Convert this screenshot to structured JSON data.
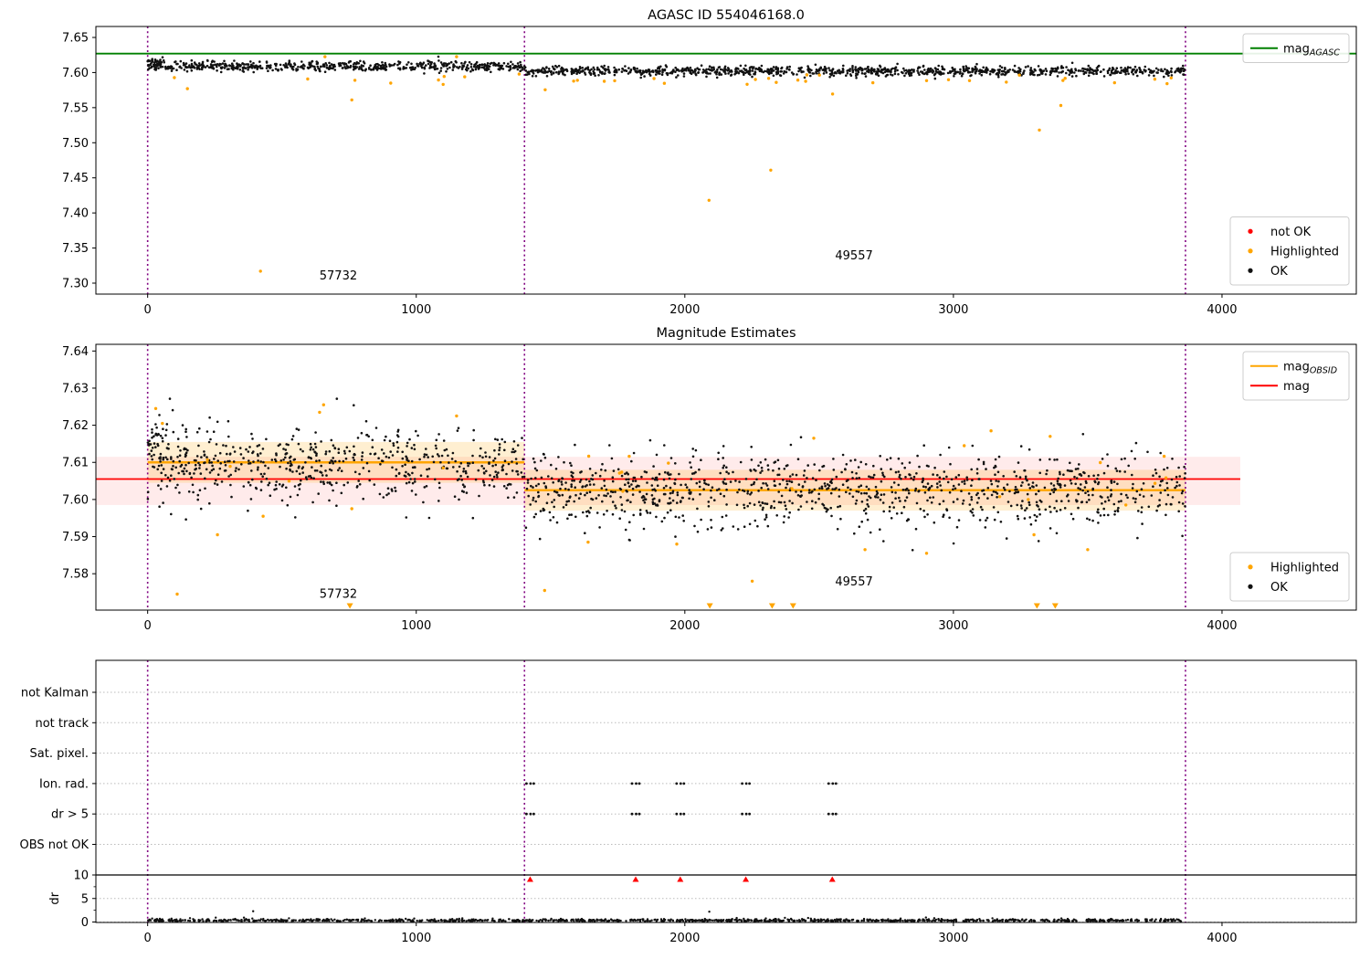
{
  "colors": {
    "green": "#008000",
    "orange": "#ffa500",
    "red": "#ff0000",
    "purple": "#800080",
    "black": "#111111",
    "pink_band": "rgba(255,0,0,0.08)",
    "orange_band": "rgba(255,165,0,0.18)",
    "grid": "#bbbbbb",
    "spine": "#000000",
    "background": "#ffffff"
  },
  "chart_data": [
    {
      "id": "agasc",
      "type": "scatter",
      "title": "AGASC ID 554046168.0",
      "xlim": [
        -192.7,
        4500
      ],
      "ylim": [
        7.2844,
        7.6656
      ],
      "xticks": [
        0,
        1000,
        2000,
        3000,
        4000
      ],
      "yticks": [
        7.3,
        7.35,
        7.4,
        7.45,
        7.5,
        7.55,
        7.6,
        7.65
      ],
      "ydecimals": 2,
      "vlines": {
        "x": [
          0,
          1403,
          3864
        ],
        "color": "purple",
        "style": "dotted"
      },
      "hlines": [
        {
          "y": 7.627,
          "x0": -192.7,
          "x1": 4500,
          "color": "green",
          "width": 1.8
        }
      ],
      "annotations": [
        {
          "text": "57732",
          "x": 710,
          "y": 7.305
        },
        {
          "text": "49557",
          "x": 2630,
          "y": 7.334
        }
      ],
      "ok_series": {
        "name": "OK",
        "color": "black",
        "clusters": [
          {
            "x0": 0,
            "x1": 60,
            "mean": 7.6135,
            "sd": 0.004,
            "n": 30
          },
          {
            "x0": 0,
            "x1": 1403,
            "mean": 7.609,
            "sd": 0.0035,
            "n": 620
          },
          {
            "x0": 1403,
            "x1": 3864,
            "mean": 7.602,
            "sd": 0.0035,
            "n": 1050
          }
        ]
      },
      "highlighted_series": {
        "name": "Highlighted",
        "color": "orange",
        "random": {
          "x0": 60,
          "x1": 3840,
          "ymin": 7.583,
          "ymax": 7.5995,
          "n": 26
        },
        "points": [
          [
            148,
            7.577
          ],
          [
            420,
            7.317
          ],
          [
            660,
            7.6225
          ],
          [
            760,
            7.561
          ],
          [
            905,
            7.585
          ],
          [
            1150,
            7.6225
          ],
          [
            1480,
            7.5755
          ],
          [
            1600,
            7.589
          ],
          [
            1700,
            7.5875
          ],
          [
            2090,
            7.418
          ],
          [
            2320,
            7.461
          ],
          [
            2450,
            7.5875
          ],
          [
            2550,
            7.5695
          ],
          [
            2700,
            7.5855
          ],
          [
            2900,
            7.5885
          ],
          [
            3060,
            7.5885
          ],
          [
            3320,
            7.518
          ],
          [
            3400,
            7.553
          ],
          [
            3600,
            7.5855
          ],
          [
            3750,
            7.5905
          ]
        ]
      },
      "notok_series": {
        "name": "not OK",
        "color": "red",
        "points": []
      },
      "legends": [
        {
          "pos": "top-right",
          "w": 116,
          "items": [
            {
              "marker": "line",
              "color": "green",
              "label": "mag",
              "sub": "AGASC"
            }
          ]
        },
        {
          "pos": "bottom-right",
          "w": 130,
          "items": [
            {
              "marker": "dot",
              "color": "red",
              "label": "not OK"
            },
            {
              "marker": "dot",
              "color": "orange",
              "label": "Highlighted"
            },
            {
              "marker": "dot",
              "color": "black",
              "label": "OK"
            }
          ]
        }
      ]
    },
    {
      "id": "magest",
      "type": "scatter",
      "title": "Magnitude Estimates",
      "xlim": [
        -192.7,
        4500
      ],
      "ylim": [
        7.5702,
        7.6418
      ],
      "xticks": [
        0,
        1000,
        2000,
        3000,
        4000
      ],
      "yticks": [
        7.58,
        7.59,
        7.6,
        7.61,
        7.62,
        7.63,
        7.64
      ],
      "ydecimals": 2,
      "vlines": {
        "x": [
          0,
          1403,
          3864
        ],
        "color": "purple",
        "style": "dotted"
      },
      "bands": [
        {
          "x0": -192.7,
          "x1": 4068,
          "y0": 7.5985,
          "y1": 7.6115,
          "color": "pink_band"
        },
        {
          "x0": 0,
          "x1": 1403,
          "y0": 7.6045,
          "y1": 7.6155,
          "color": "orange_band"
        },
        {
          "x0": 1403,
          "x1": 3864,
          "y0": 7.597,
          "y1": 7.608,
          "color": "orange_band"
        }
      ],
      "hlines": [
        {
          "y": 7.6055,
          "x0": -192.7,
          "x1": 4068,
          "color": "red",
          "width": 1.8
        },
        {
          "y": 7.61,
          "x0": 0,
          "x1": 1403,
          "color": "orange",
          "width": 2.4
        },
        {
          "y": 7.6025,
          "x0": 1403,
          "x1": 3864,
          "color": "orange",
          "width": 2.4
        }
      ],
      "annotations": [
        {
          "text": "57732",
          "x": 710,
          "y": 7.5735
        },
        {
          "text": "49557",
          "x": 2630,
          "y": 7.5768
        }
      ],
      "ok_series": {
        "name": "OK",
        "color": "black",
        "clusters": [
          {
            "x0": 0,
            "x1": 90,
            "mean": 7.6155,
            "sd": 0.005,
            "n": 35
          },
          {
            "x0": 0,
            "x1": 1403,
            "mean": 7.6095,
            "sd": 0.005,
            "n": 600
          },
          {
            "x0": 1403,
            "x1": 3864,
            "mean": 7.6025,
            "sd": 0.005,
            "n": 1050
          }
        ]
      },
      "highlighted_series": {
        "name": "Highlighted",
        "color": "orange",
        "random": {
          "x0": 30,
          "x1": 3840,
          "ymin": 7.5985,
          "ymax": 7.6125,
          "n": 18
        },
        "points": [
          [
            30,
            7.6245
          ],
          [
            55,
            7.6205
          ],
          [
            110,
            7.5745
          ],
          [
            260,
            7.5905
          ],
          [
            430,
            7.5955
          ],
          [
            640,
            7.6235
          ],
          [
            655,
            7.6255
          ],
          [
            760,
            7.5975
          ],
          [
            1150,
            7.6225
          ],
          [
            1478,
            7.5755
          ],
          [
            1640,
            7.5885
          ],
          [
            1970,
            7.588
          ],
          [
            2251,
            7.578
          ],
          [
            2480,
            7.6165
          ],
          [
            2671,
            7.5865
          ],
          [
            2900,
            7.5855
          ],
          [
            3040,
            7.6145
          ],
          [
            3140,
            7.6185
          ],
          [
            3300,
            7.5905
          ],
          [
            3360,
            7.617
          ],
          [
            3500,
            7.5865
          ]
        ],
        "clip_triangles_x": [
          753,
          2093,
          2325,
          2403,
          3311,
          3379
        ]
      },
      "legends": [
        {
          "pos": "top-right",
          "w": 116,
          "items": [
            {
              "marker": "line",
              "color": "orange",
              "label": "mag",
              "sub": "OBSID"
            },
            {
              "marker": "line",
              "color": "red",
              "label": "mag"
            }
          ]
        },
        {
          "pos": "bottom-right",
          "w": 130,
          "items": [
            {
              "marker": "dot",
              "color": "orange",
              "label": "Highlighted"
            },
            {
              "marker": "dot",
              "color": "black",
              "label": "OK"
            }
          ]
        }
      ]
    },
    {
      "id": "flags",
      "type": "scatter",
      "title": "",
      "xlim": [
        -192.7,
        4500
      ],
      "xticks": [
        0,
        1000,
        2000,
        3000,
        4000
      ],
      "vlines": {
        "x": [
          0,
          1403,
          3864
        ],
        "color": "purple",
        "style": "dotted"
      },
      "flag_rows": [
        "not Kalman",
        "not track",
        "Sat. pixel.",
        "Ion. rad.",
        "dr > 5",
        "OBS not OK"
      ],
      "flag_points": [
        {
          "row": "Ion. rad.",
          "x": [
            1424,
            1817,
            1983,
            2227,
            2549
          ]
        },
        {
          "row": "dr > 5",
          "x": [
            1424,
            1817,
            1983,
            2227,
            2549
          ]
        }
      ],
      "dr_axis": {
        "label": "dr",
        "ticks": [
          0,
          5,
          10
        ],
        "max_line": 10,
        "red_triangles_x": [
          1424,
          1817,
          1983,
          2227,
          2549
        ],
        "trace": {
          "x0": 0,
          "x1": 3864,
          "n": 1150,
          "base": 0.18,
          "sd": 0.22
        },
        "isolated_points": [
          [
            393,
            2.3
          ],
          [
            2091,
            2.2
          ]
        ]
      }
    }
  ]
}
